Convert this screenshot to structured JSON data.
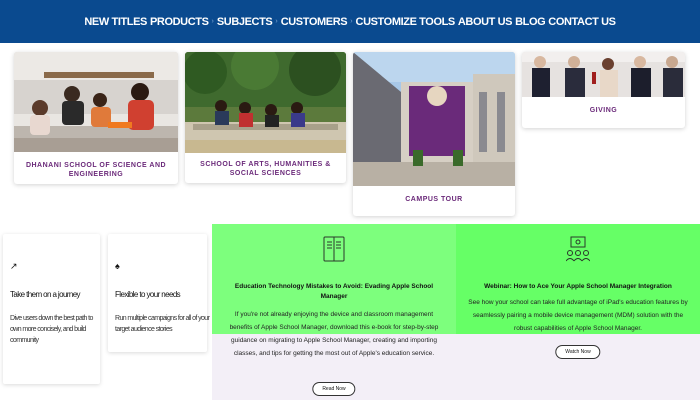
{
  "nav": {
    "new_titles": "NEW TITLES",
    "products": "PRODUCTS",
    "subjects": "SUBJECTS",
    "customers": "CUSTOMERS",
    "customize_tools": "CUSTOMIZE TOOLS",
    "about_us": "ABOUT US",
    "blog": "BLOG",
    "contact_us": "CONTACT US"
  },
  "cards": {
    "science": "DHANANI SCHOOL OF SCIENCE AND ENGINEERING",
    "arts": "SCHOOL OF ARTS, HUMANITIES & SOCIAL SCIENCES",
    "campus": "CAMPUS TOUR",
    "giving": "GIVING"
  },
  "features": [
    {
      "icon": "arrow-icon",
      "title": "Take them on a journey",
      "text": "Dive users down the best path to own more concisely, and build community"
    },
    {
      "icon": "spade-icon",
      "title": "Flexible to your needs",
      "text": "Run multiple campaigns for all of your target audience stories"
    }
  ],
  "panels": [
    {
      "title": "Education Technology Mistakes to Avoid: Evading Apple School Manager",
      "body": "If you're not already enjoying the device and classroom management benefits of Apple School Manager, download this e-book for step-by-step guidance on migrating to Apple School Manager, creating and importing classes, and tips for getting the most out of Apple's education service.",
      "button": "Read Now",
      "green": "#7dff7d"
    },
    {
      "title": "Webinar: How to Ace Your Apple School Manager Integration",
      "body": "See how your school can take full advantage of iPad's education features by seamlessly pairing a mobile device management (MDM) solution with the robust capabilities of Apple School Manager.",
      "button": "Watch Now",
      "green": "#66ff66"
    }
  ],
  "colors": {
    "nav_bg": "#0a4a8f",
    "caption": "#6b2a7a",
    "lavender": "#f3eff7"
  }
}
